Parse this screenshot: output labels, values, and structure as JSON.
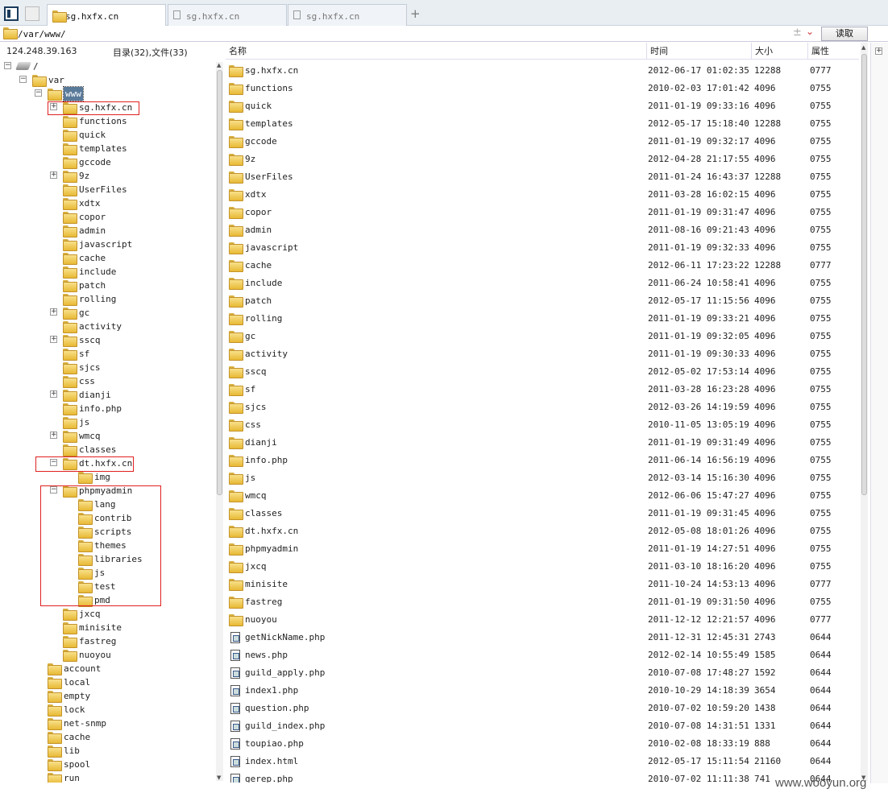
{
  "tabs": [
    {
      "label": "sg.hxfx.cn",
      "active": true
    },
    {
      "label": "sg.hxfx.cn",
      "active": false
    },
    {
      "label": "sg.hxfx.cn",
      "active": false
    }
  ],
  "new_tab_label": "+",
  "address": {
    "value": "/var/www/",
    "plus": "±",
    "read_button": "读取"
  },
  "status": {
    "ip": "124.248.39.163",
    "counts": "目录(32),文件(33)"
  },
  "columns": {
    "name": "名称",
    "time": "时间",
    "size": "大小",
    "attr": "属性"
  },
  "tree": [
    {
      "label": "/",
      "depth": 0,
      "expander": "−",
      "icon": "drive"
    },
    {
      "label": "var",
      "depth": 1,
      "expander": "−"
    },
    {
      "label": "www",
      "depth": 2,
      "expander": "−",
      "selected": true
    },
    {
      "label": "sg.hxfx.cn",
      "depth": 3,
      "expander": "+"
    },
    {
      "label": "functions",
      "depth": 3
    },
    {
      "label": "quick",
      "depth": 3
    },
    {
      "label": "templates",
      "depth": 3
    },
    {
      "label": "gccode",
      "depth": 3
    },
    {
      "label": "9z",
      "depth": 3,
      "expander": "+"
    },
    {
      "label": "UserFiles",
      "depth": 3
    },
    {
      "label": "xdtx",
      "depth": 3
    },
    {
      "label": "copor",
      "depth": 3
    },
    {
      "label": "admin",
      "depth": 3
    },
    {
      "label": "javascript",
      "depth": 3
    },
    {
      "label": "cache",
      "depth": 3
    },
    {
      "label": "include",
      "depth": 3
    },
    {
      "label": "patch",
      "depth": 3
    },
    {
      "label": "rolling",
      "depth": 3
    },
    {
      "label": "gc",
      "depth": 3,
      "expander": "+"
    },
    {
      "label": "activity",
      "depth": 3
    },
    {
      "label": "sscq",
      "depth": 3,
      "expander": "+"
    },
    {
      "label": "sf",
      "depth": 3
    },
    {
      "label": "sjcs",
      "depth": 3
    },
    {
      "label": "css",
      "depth": 3
    },
    {
      "label": "dianji",
      "depth": 3,
      "expander": "+"
    },
    {
      "label": "info.php",
      "depth": 3
    },
    {
      "label": "js",
      "depth": 3
    },
    {
      "label": "wmcq",
      "depth": 3,
      "expander": "+"
    },
    {
      "label": "classes",
      "depth": 3
    },
    {
      "label": "dt.hxfx.cn",
      "depth": 3,
      "expander": "−"
    },
    {
      "label": "img",
      "depth": 4
    },
    {
      "label": "phpmyadmin",
      "depth": 3,
      "expander": "−"
    },
    {
      "label": "lang",
      "depth": 4
    },
    {
      "label": "contrib",
      "depth": 4
    },
    {
      "label": "scripts",
      "depth": 4
    },
    {
      "label": "themes",
      "depth": 4
    },
    {
      "label": "libraries",
      "depth": 4
    },
    {
      "label": "js",
      "depth": 4
    },
    {
      "label": "test",
      "depth": 4
    },
    {
      "label": "pmd",
      "depth": 4
    },
    {
      "label": "jxcq",
      "depth": 3
    },
    {
      "label": "minisite",
      "depth": 3
    },
    {
      "label": "fastreg",
      "depth": 3
    },
    {
      "label": "nuoyou",
      "depth": 3
    },
    {
      "label": "account",
      "depth": 2
    },
    {
      "label": "local",
      "depth": 2
    },
    {
      "label": "empty",
      "depth": 2
    },
    {
      "label": "lock",
      "depth": 2
    },
    {
      "label": "net-snmp",
      "depth": 2
    },
    {
      "label": "cache",
      "depth": 2
    },
    {
      "label": "lib",
      "depth": 2
    },
    {
      "label": "spool",
      "depth": 2
    },
    {
      "label": "run",
      "depth": 2
    }
  ],
  "files": [
    {
      "name": "sg.hxfx.cn",
      "time": "2012-06-17 01:02:35",
      "size": "12288",
      "perm": "0777",
      "type": "folder"
    },
    {
      "name": "functions",
      "time": "2010-02-03 17:01:42",
      "size": "4096",
      "perm": "0755",
      "type": "folder"
    },
    {
      "name": "quick",
      "time": "2011-01-19 09:33:16",
      "size": "4096",
      "perm": "0755",
      "type": "folder"
    },
    {
      "name": "templates",
      "time": "2012-05-17 15:18:40",
      "size": "12288",
      "perm": "0755",
      "type": "folder"
    },
    {
      "name": "gccode",
      "time": "2011-01-19 09:32:17",
      "size": "4096",
      "perm": "0755",
      "type": "folder"
    },
    {
      "name": "9z",
      "time": "2012-04-28 21:17:55",
      "size": "4096",
      "perm": "0755",
      "type": "folder"
    },
    {
      "name": "UserFiles",
      "time": "2011-01-24 16:43:37",
      "size": "12288",
      "perm": "0755",
      "type": "folder"
    },
    {
      "name": "xdtx",
      "time": "2011-03-28 16:02:15",
      "size": "4096",
      "perm": "0755",
      "type": "folder"
    },
    {
      "name": "copor",
      "time": "2011-01-19 09:31:47",
      "size": "4096",
      "perm": "0755",
      "type": "folder"
    },
    {
      "name": "admin",
      "time": "2011-08-16 09:21:43",
      "size": "4096",
      "perm": "0755",
      "type": "folder"
    },
    {
      "name": "javascript",
      "time": "2011-01-19 09:32:33",
      "size": "4096",
      "perm": "0755",
      "type": "folder"
    },
    {
      "name": "cache",
      "time": "2012-06-11 17:23:22",
      "size": "12288",
      "perm": "0777",
      "type": "folder"
    },
    {
      "name": "include",
      "time": "2011-06-24 10:58:41",
      "size": "4096",
      "perm": "0755",
      "type": "folder"
    },
    {
      "name": "patch",
      "time": "2012-05-17 11:15:56",
      "size": "4096",
      "perm": "0755",
      "type": "folder"
    },
    {
      "name": "rolling",
      "time": "2011-01-19 09:33:21",
      "size": "4096",
      "perm": "0755",
      "type": "folder"
    },
    {
      "name": "gc",
      "time": "2011-01-19 09:32:05",
      "size": "4096",
      "perm": "0755",
      "type": "folder"
    },
    {
      "name": "activity",
      "time": "2011-01-19 09:30:33",
      "size": "4096",
      "perm": "0755",
      "type": "folder"
    },
    {
      "name": "sscq",
      "time": "2012-05-02 17:53:14",
      "size": "4096",
      "perm": "0755",
      "type": "folder"
    },
    {
      "name": "sf",
      "time": "2011-03-28 16:23:28",
      "size": "4096",
      "perm": "0755",
      "type": "folder"
    },
    {
      "name": "sjcs",
      "time": "2012-03-26 14:19:59",
      "size": "4096",
      "perm": "0755",
      "type": "folder"
    },
    {
      "name": "css",
      "time": "2010-11-05 13:05:19",
      "size": "4096",
      "perm": "0755",
      "type": "folder"
    },
    {
      "name": "dianji",
      "time": "2011-01-19 09:31:49",
      "size": "4096",
      "perm": "0755",
      "type": "folder"
    },
    {
      "name": "info.php",
      "time": "2011-06-14 16:56:19",
      "size": "4096",
      "perm": "0755",
      "type": "folder"
    },
    {
      "name": "js",
      "time": "2012-03-14 15:16:30",
      "size": "4096",
      "perm": "0755",
      "type": "folder"
    },
    {
      "name": "wmcq",
      "time": "2012-06-06 15:47:27",
      "size": "4096",
      "perm": "0755",
      "type": "folder"
    },
    {
      "name": "classes",
      "time": "2011-01-19 09:31:45",
      "size": "4096",
      "perm": "0755",
      "type": "folder"
    },
    {
      "name": "dt.hxfx.cn",
      "time": "2012-05-08 18:01:26",
      "size": "4096",
      "perm": "0755",
      "type": "folder"
    },
    {
      "name": "phpmyadmin",
      "time": "2011-01-19 14:27:51",
      "size": "4096",
      "perm": "0755",
      "type": "folder"
    },
    {
      "name": "jxcq",
      "time": "2011-03-10 18:16:20",
      "size": "4096",
      "perm": "0755",
      "type": "folder"
    },
    {
      "name": "minisite",
      "time": "2011-10-24 14:53:13",
      "size": "4096",
      "perm": "0777",
      "type": "folder"
    },
    {
      "name": "fastreg",
      "time": "2011-01-19 09:31:50",
      "size": "4096",
      "perm": "0755",
      "type": "folder"
    },
    {
      "name": "nuoyou",
      "time": "2011-12-12 12:21:57",
      "size": "4096",
      "perm": "0777",
      "type": "folder"
    },
    {
      "name": "getNickName.php",
      "time": "2011-12-31 12:45:31",
      "size": "2743",
      "perm": "0644",
      "type": "file"
    },
    {
      "name": "news.php",
      "time": "2012-02-14 10:55:49",
      "size": "1585",
      "perm": "0644",
      "type": "file"
    },
    {
      "name": "guild_apply.php",
      "time": "2010-07-08 17:48:27",
      "size": "1592",
      "perm": "0644",
      "type": "file"
    },
    {
      "name": "index1.php",
      "time": "2010-10-29 14:18:39",
      "size": "3654",
      "perm": "0644",
      "type": "file"
    },
    {
      "name": "question.php",
      "time": "2010-07-02 10:59:20",
      "size": "1438",
      "perm": "0644",
      "type": "file"
    },
    {
      "name": "guild_index.php",
      "time": "2010-07-08 14:31:51",
      "size": "1331",
      "perm": "0644",
      "type": "file"
    },
    {
      "name": "toupiao.php",
      "time": "2010-02-08 18:33:19",
      "size": "888",
      "perm": "0644",
      "type": "file"
    },
    {
      "name": "index.html",
      "time": "2012-05-17 15:11:54",
      "size": "21160",
      "perm": "0644",
      "type": "file"
    },
    {
      "name": "gerep.php",
      "time": "2010-07-02 11:11:38",
      "size": "741",
      "perm": "0644",
      "type": "file"
    }
  ],
  "watermark": "www.wooyun.org",
  "colors": {
    "highlight_box": "#e02020",
    "folder": "#e8b934",
    "selected": "#5a7a9a"
  }
}
